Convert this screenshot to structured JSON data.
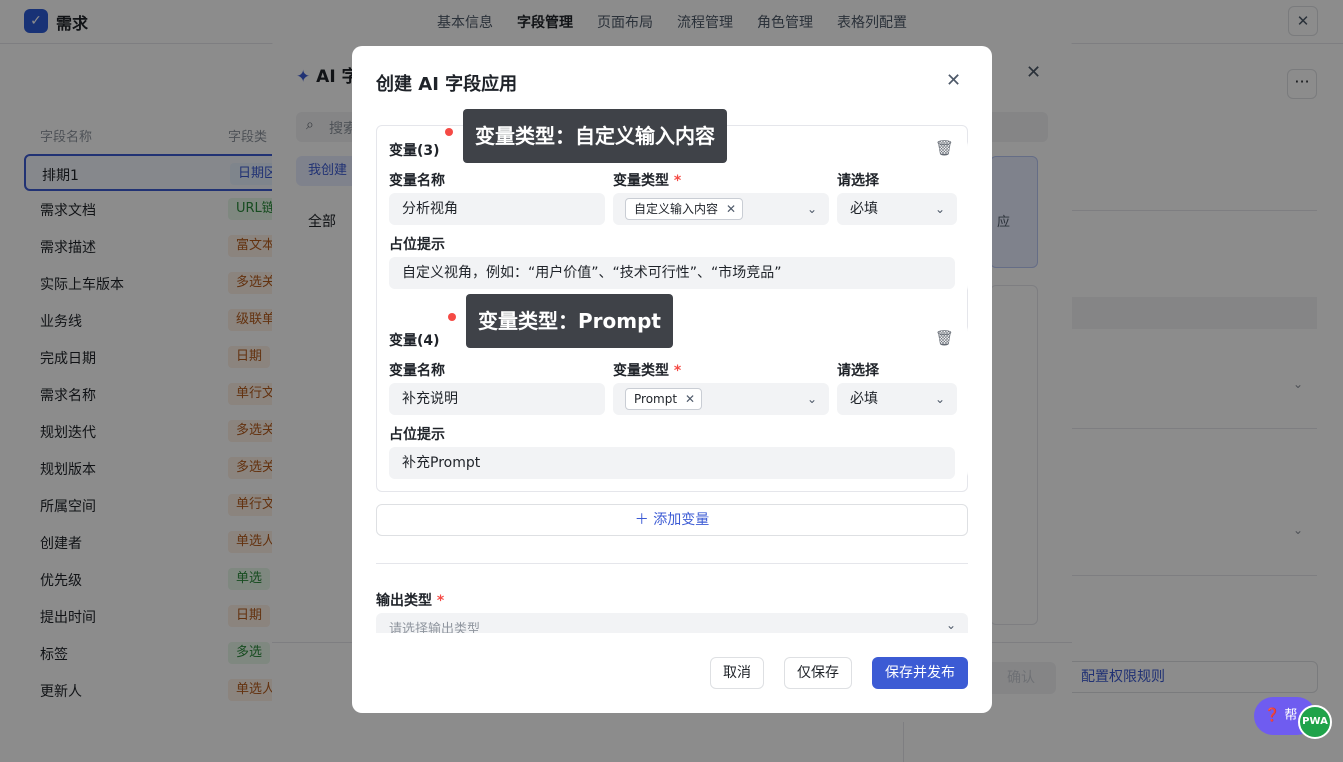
{
  "app": {
    "logo_icon": "circle-check-icon",
    "title": "需求"
  },
  "nav_tabs": [
    "基本信息",
    "字段管理",
    "页面布局",
    "流程管理",
    "角色管理",
    "表格列配置"
  ],
  "active_nav_tab": "字段管理",
  "field_list": {
    "headers": {
      "name": "字段名称",
      "type": "字段类"
    },
    "rows": [
      {
        "name": "排期1",
        "type": "日期区"
      },
      {
        "name": "需求文档",
        "type": "URL链"
      },
      {
        "name": "需求描述",
        "type": "富文本"
      },
      {
        "name": "实际上车版本",
        "type": "多选关"
      },
      {
        "name": "业务线",
        "type": "级联单"
      },
      {
        "name": "完成日期",
        "type": "日期"
      },
      {
        "name": "需求名称",
        "type": "单行文"
      },
      {
        "name": "规划迭代",
        "type": "多选关"
      },
      {
        "name": "规划版本",
        "type": "多选关"
      },
      {
        "name": "所属空间",
        "type": "单行文"
      },
      {
        "name": "创建者",
        "type": "单选人"
      },
      {
        "name": "优先级",
        "type": "单选"
      },
      {
        "name": "提出时间",
        "type": "日期"
      },
      {
        "name": "标签",
        "type": "多选"
      },
      {
        "name": "更新人",
        "type": "单选人"
      }
    ]
  },
  "back_modal": {
    "title": "AI 字",
    "search_placeholder": "搜索",
    "tab_mine": "我创建",
    "tab_all": "全部",
    "card_text": "应",
    "confirm": "确认"
  },
  "right_panel": {
    "more_icon": "more-horizontal-icon",
    "permission_button": "配置权限规则",
    "help": "帮",
    "pwa": "PWA"
  },
  "dialog": {
    "title": "创建 AI 字段应用",
    "variables": [
      {
        "title": "变量(3)",
        "name_label": "变量名称",
        "name_value": "分析视角",
        "type_label": "变量类型",
        "type_value": "自定义输入内容",
        "select_label": "请选择",
        "select_value": "必填",
        "hint_label": "占位提示",
        "hint_value": "自定义视角，例如：“用户价值”、“技术可行性”、“市场竞品”",
        "tooltip": "变量类型：自定义输入内容"
      },
      {
        "title": "变量(4)",
        "name_label": "变量名称",
        "name_value": "补充说明",
        "type_label": "变量类型",
        "type_value": "Prompt",
        "select_label": "请选择",
        "select_value": "必填",
        "hint_label": "占位提示",
        "hint_value": "补充Prompt",
        "tooltip": "变量类型：Prompt"
      }
    ],
    "add_variable": "添加变量",
    "output_type_label": "输出类型",
    "output_type_placeholder": "请选择输出类型",
    "buttons": {
      "cancel": "取消",
      "save_only": "仅保存",
      "save_publish": "保存并发布"
    }
  },
  "colors": {
    "accent": "#3c5bd4",
    "required": "#f54a45",
    "tooltip_bg": "#3f4248"
  }
}
